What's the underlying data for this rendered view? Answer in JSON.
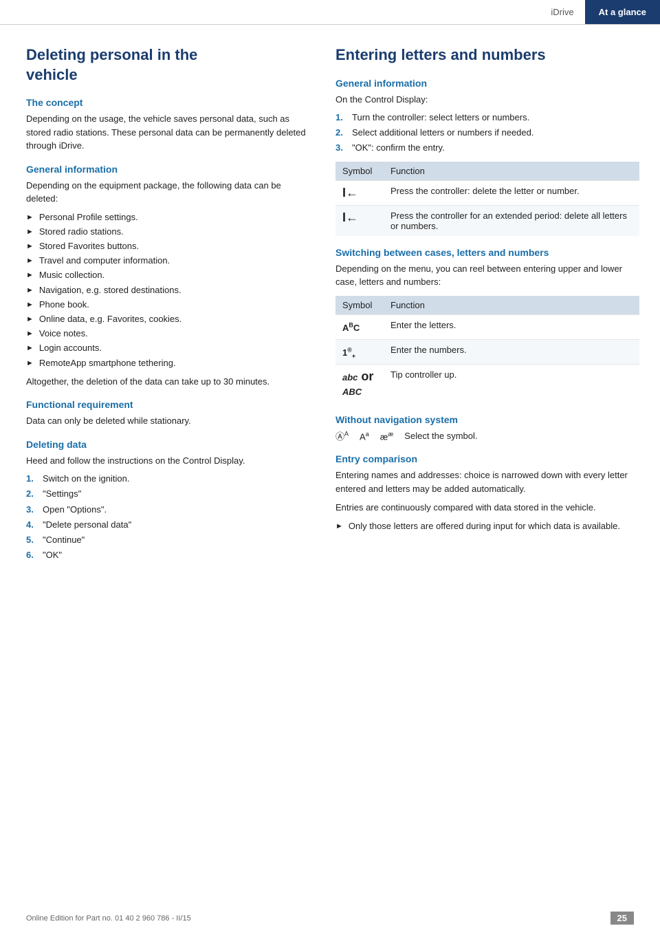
{
  "header": {
    "idrive_label": "iDrive",
    "at_a_glance_label": "At a glance"
  },
  "left": {
    "page_title_line1": "Deleting personal in the",
    "page_title_line2": "vehicle",
    "section1": {
      "heading": "The concept",
      "body": "Depending on the usage, the vehicle saves personal data, such as stored radio stations. These personal data can be permanently deleted through iDrive."
    },
    "section2": {
      "heading": "General information",
      "intro": "Depending on the equipment package, the following data can be deleted:",
      "bullets": [
        "Personal Profile settings.",
        "Stored radio stations.",
        "Stored Favorites buttons.",
        "Travel and computer information.",
        "Music collection.",
        "Navigation, e.g. stored destinations.",
        "Phone book.",
        "Online data, e.g. Favorites, cookies.",
        "Voice notes.",
        "Login accounts.",
        "RemoteApp smartphone tethering."
      ],
      "footer_text": "Altogether, the deletion of the data can take up to 30 minutes."
    },
    "section3": {
      "heading": "Functional requirement",
      "body": "Data can only be deleted while stationary."
    },
    "section4": {
      "heading": "Deleting data",
      "intro": "Heed and follow the instructions on the Control Display.",
      "steps": [
        "Switch on the ignition.",
        "\"Settings\"",
        "Open \"Options\".",
        "\"Delete personal data\"",
        "\"Continue\"",
        "\"OK\""
      ]
    }
  },
  "right": {
    "page_title": "Entering letters and numbers",
    "section1": {
      "heading": "General information",
      "intro": "On the Control Display:",
      "steps": [
        "Turn the controller: select letters or numbers.",
        "Select additional letters or numbers if needed.",
        "\"OK\": confirm the entry."
      ],
      "table": {
        "col1": "Symbol",
        "col2": "Function",
        "rows": [
          {
            "symbol": "I←",
            "function": "Press the controller: delete the letter or number."
          },
          {
            "symbol": "I←",
            "function": "Press the controller for an extended period: delete all letters or numbers."
          }
        ]
      }
    },
    "section2": {
      "heading": "Switching between cases, letters and numbers",
      "intro": "Depending on the menu, you can reel between entering upper and lower case, letters and numbers:",
      "table": {
        "col1": "Symbol",
        "col2": "Function",
        "rows": [
          {
            "symbol": "AᴪC",
            "function": "Enter the letters."
          },
          {
            "symbol": "1®₊",
            "function": "Enter the numbers."
          },
          {
            "symbol": "abc or ABC",
            "function": "Tip controller up."
          }
        ]
      }
    },
    "section3": {
      "heading": "Without navigation system",
      "symbols_text": "ⓐᴪ   ᴀᴪ   æᴪ   Select the symbol."
    },
    "section4": {
      "heading": "Entry comparison",
      "body1": "Entering names and addresses: choice is narrowed down with every letter entered and letters may be added automatically.",
      "body2": "Entries are continuously compared with data stored in the vehicle.",
      "bullet": "Only those letters are offered during input for which data is available."
    }
  },
  "footer": {
    "copyright": "Online Edition for Part no. 01 40 2 960 786 - II/15",
    "page_number": "25"
  }
}
